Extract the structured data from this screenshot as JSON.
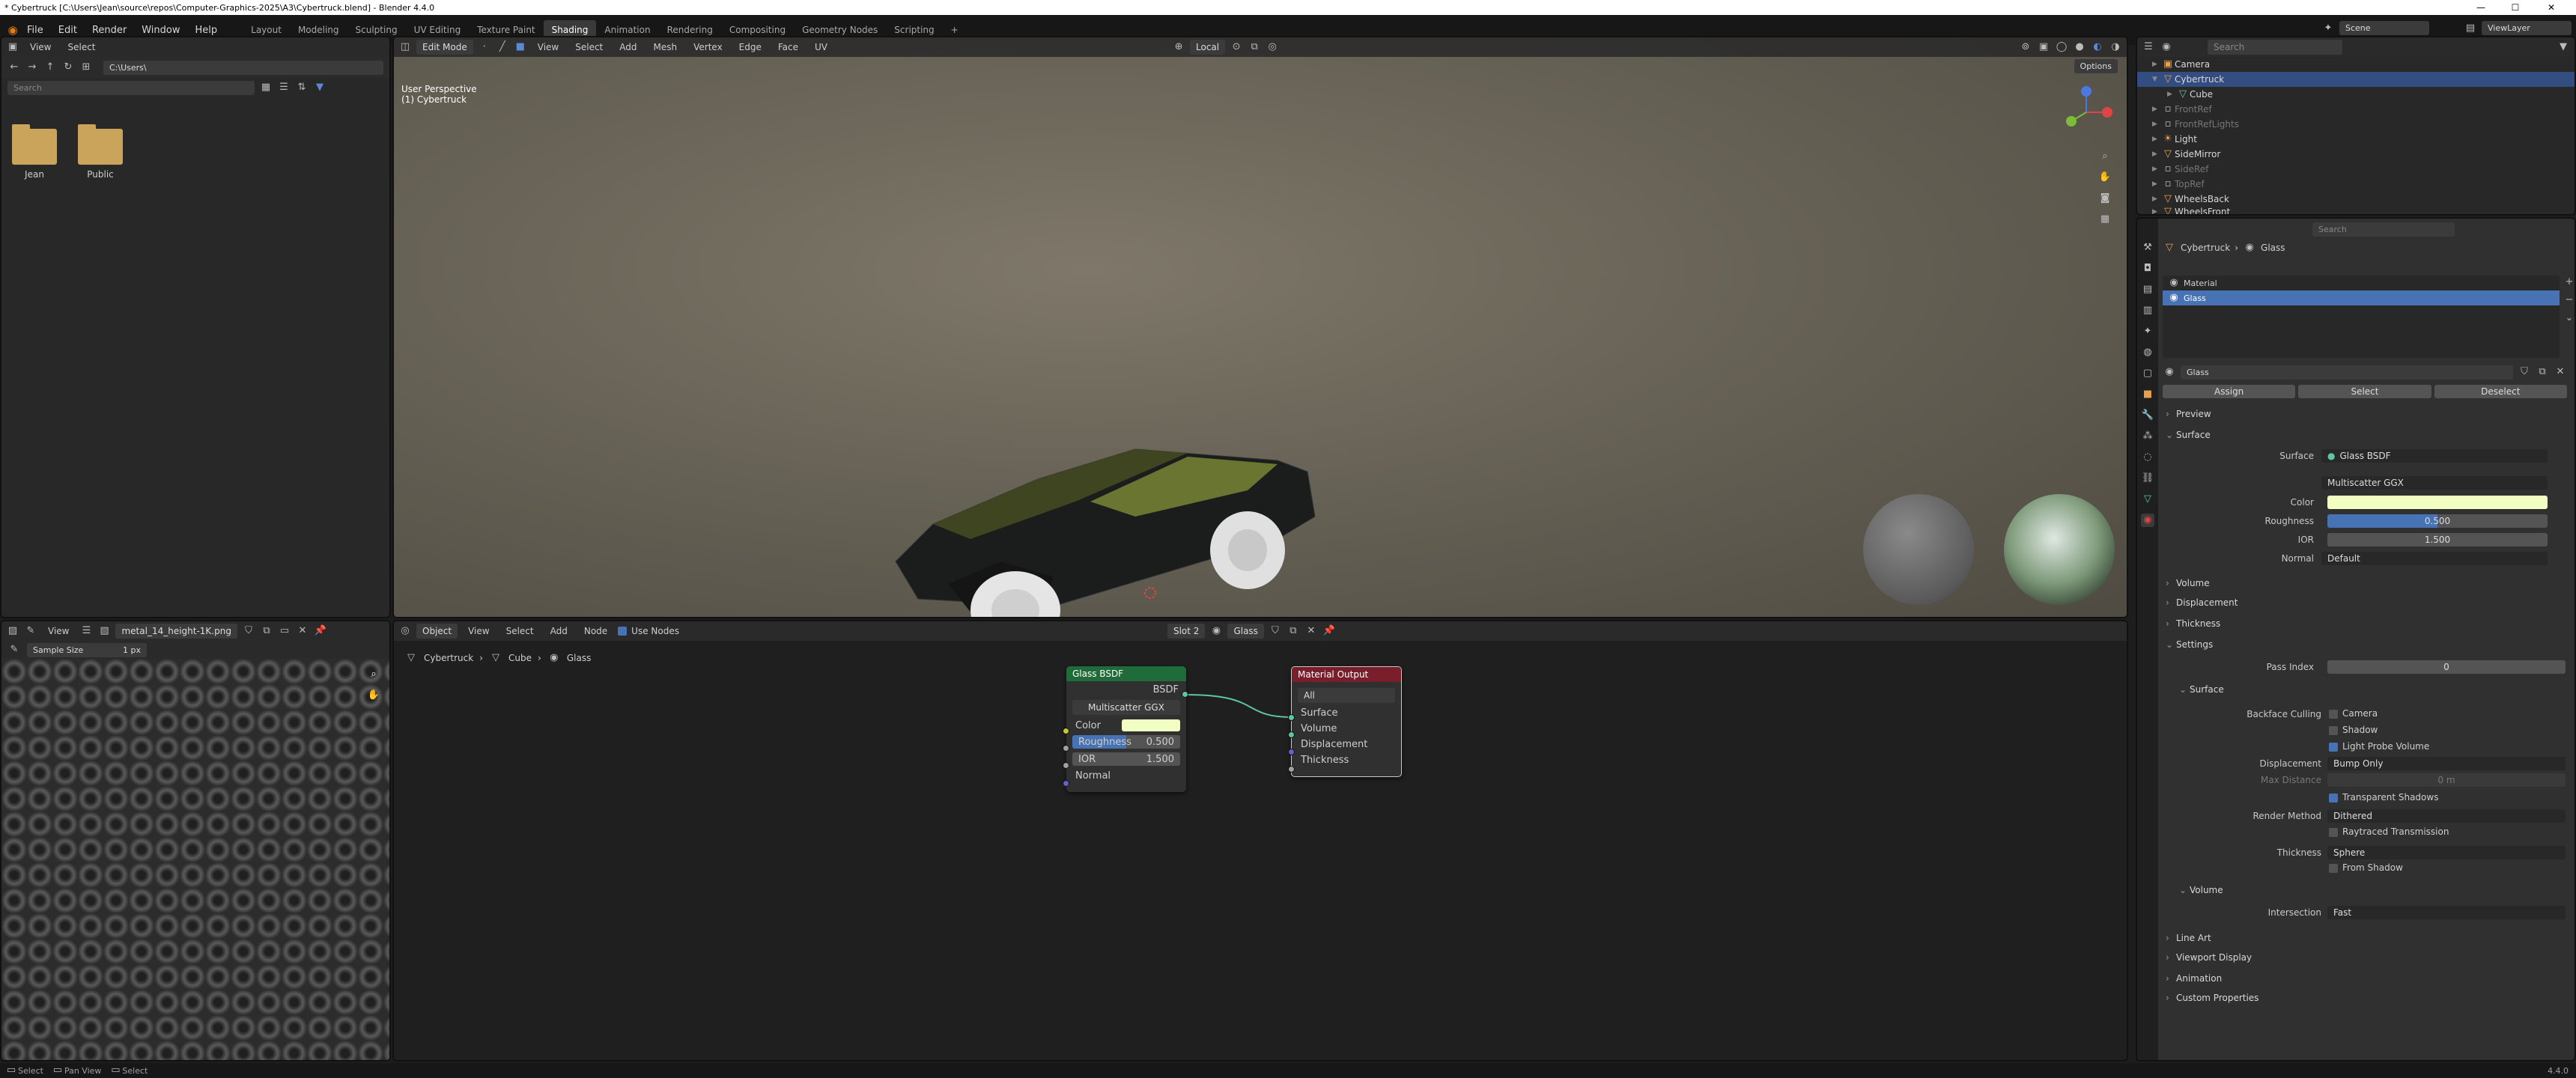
{
  "window": {
    "title": "* Cybertruck [C:\\Users\\Jean\\source\\repos\\Computer-Graphics-2025\\A3\\Cybertruck.blend] - Blender 4.4.0",
    "min": "—",
    "max": "☐",
    "close": "✕"
  },
  "menu": [
    "File",
    "Edit",
    "Render",
    "Window",
    "Help"
  ],
  "workspaces": [
    "Layout",
    "Modeling",
    "Sculpting",
    "UV Editing",
    "Texture Paint",
    "Shading",
    "Animation",
    "Rendering",
    "Compositing",
    "Geometry Nodes",
    "Scripting",
    "+"
  ],
  "active_workspace": "Shading",
  "top_right": {
    "scene": "Scene",
    "view_layer": "ViewLayer"
  },
  "file_browser": {
    "view": "View",
    "select": "Select",
    "path": "C:\\Users\\",
    "search_placeholder": "Search",
    "folders": [
      {
        "name": "Jean"
      },
      {
        "name": "Public"
      }
    ]
  },
  "viewport": {
    "mode": "Edit Mode",
    "menus": [
      "View",
      "Select",
      "Add",
      "Mesh",
      "Vertex",
      "Edge",
      "Face",
      "UV"
    ],
    "orientation": "Local",
    "options": "Options",
    "overlay_line1": "User Perspective",
    "overlay_line2": "(1) Cybertruck"
  },
  "outliner": {
    "search_placeholder": "Search",
    "items": [
      {
        "name": "Camera",
        "state": "normal"
      },
      {
        "name": "Cybertruck",
        "state": "selected"
      },
      {
        "name": "Cube",
        "state": "child"
      },
      {
        "name": "FrontRef",
        "state": "dim"
      },
      {
        "name": "FrontRefLights",
        "state": "dim"
      },
      {
        "name": "Light",
        "state": "normal"
      },
      {
        "name": "SideMirror",
        "state": "normal"
      },
      {
        "name": "SideRef",
        "state": "dim"
      },
      {
        "name": "TopRef",
        "state": "dim"
      },
      {
        "name": "WheelsBack",
        "state": "normal"
      },
      {
        "name": "WheelsFront",
        "state": "normal"
      }
    ]
  },
  "image_editor": {
    "view": "View",
    "image_name": "metal_14_height-1K.png",
    "sample_label": "Sample Size",
    "sample_value": "1 px"
  },
  "node_editor": {
    "object": "Object",
    "menus": [
      "View",
      "Select",
      "Add",
      "Node"
    ],
    "use_nodes": "Use Nodes",
    "slot": "Slot 2",
    "material": "Glass",
    "breadcrumb": [
      "Cybertruck",
      "Cube",
      "Glass"
    ],
    "glass_node": {
      "title": "Glass BSDF",
      "output": "BSDF",
      "distribution": "Multiscatter GGX",
      "color": "Color",
      "roughness_label": "Roughness",
      "roughness_value": "0.500",
      "ior_label": "IOR",
      "ior_value": "1.500",
      "normal": "Normal"
    },
    "output_node": {
      "title": "Material Output",
      "target": "All",
      "inputs": [
        "Surface",
        "Volume",
        "Displacement",
        "Thickness"
      ]
    }
  },
  "properties": {
    "search_placeholder": "Search",
    "breadcrumb": [
      "Cybertruck",
      "Glass"
    ],
    "slots": [
      "Material",
      "Glass"
    ],
    "material_name": "Glass",
    "buttons": [
      "Assign",
      "Select",
      "Deselect"
    ],
    "sections": {
      "preview": "Preview",
      "surface": "Surface",
      "volume": "Volume",
      "displacement": "Displacement",
      "thickness": "Thickness",
      "settings": "Settings",
      "line_art": "Line Art",
      "viewport_display": "Viewport Display",
      "animation": "Animation",
      "custom_props": "Custom Properties"
    },
    "surface": {
      "surface_label": "Surface",
      "surface_value": "Glass BSDF",
      "distribution": "Multiscatter GGX",
      "color_label": "Color",
      "roughness_label": "Roughness",
      "roughness_value": "0.500",
      "ior_label": "IOR",
      "ior_value": "1.500",
      "normal_label": "Normal",
      "normal_value": "Default"
    },
    "settings": {
      "pass_index_label": "Pass Index",
      "pass_index_value": "0",
      "surface_sub": "Surface",
      "backface_label": "Backface Culling",
      "camera": "Camera",
      "shadow": "Shadow",
      "light_probe": "Light Probe Volume",
      "displacement_label": "Displacement",
      "displacement_value": "Bump Only",
      "max_distance_label": "Max Distance",
      "max_distance_value": "0 m",
      "transparent_shadows": "Transparent Shadows",
      "render_method_label": "Render Method",
      "render_method_value": "Dithered",
      "raytraced": "Raytraced Transmission",
      "thickness_label": "Thickness",
      "thickness_value": "Sphere",
      "from_shadow": "From Shadow",
      "volume_sub": "Volume",
      "intersection_label": "Intersection",
      "intersection_value": "Fast"
    }
  },
  "statusbar": {
    "select": "Select",
    "pan": "Pan View",
    "select2": "Select",
    "version": "4.4.0"
  },
  "colors": {
    "accent": "#4772b3",
    "selected_row": "#334d80",
    "glass_header": "#1f6b3a",
    "output_header": "#7a1e2b",
    "color_swatch": "#f2ffc2"
  }
}
